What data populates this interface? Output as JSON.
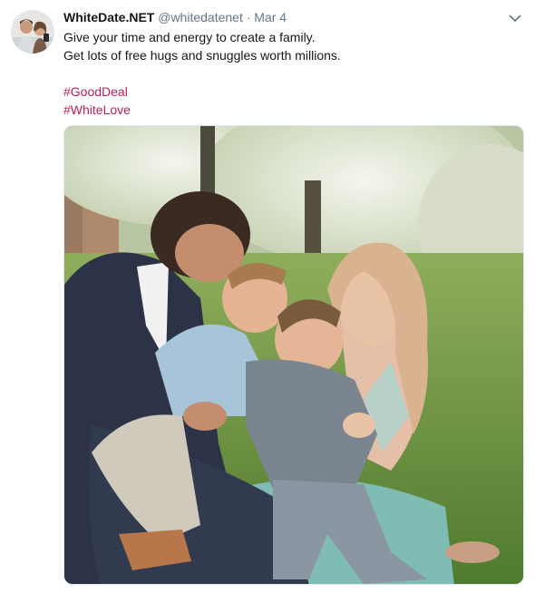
{
  "tweet": {
    "display_name": "WhiteDate.NET",
    "handle": "@whitedatenet",
    "separator": "·",
    "date": "Mar 4",
    "lines": [
      "Give your time and energy to create a family.",
      "Get lots of free hugs and snuggles worth millions."
    ],
    "hashtags": [
      "#GoodDeal",
      "#WhiteLove"
    ]
  },
  "icons": {
    "menu": "chevron-down-icon"
  },
  "colors": {
    "name": "#14171a",
    "muted": "#657786",
    "hashtag": "#c01c59"
  }
}
